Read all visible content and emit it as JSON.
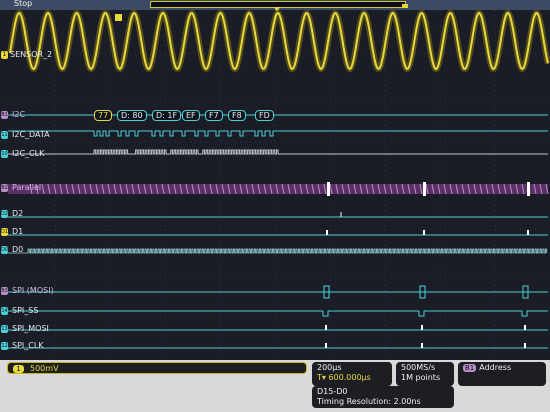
{
  "topbar": {
    "state": "Stop"
  },
  "trace_labels": {
    "sensor": "SENSOR_2",
    "i2c_bus": "I2C",
    "i2c_data": "I2C_DATA",
    "i2c_clk": "I2C_CLK",
    "parallel_bus": "Parallel",
    "d2": "D2",
    "d1": "D1",
    "d0": "D0",
    "spi_bus": "SPI (MOSI)",
    "spi_ss": "SPI_SS",
    "spi_mosi": "SPI_MOSI",
    "spi_clk": "SPI_CLK"
  },
  "channel_marks": {
    "ch1": "1",
    "b1": "B1",
    "d11": "11",
    "d10": "10",
    "b2": "B2",
    "d2": "D2",
    "d1": "D1",
    "d0": "D0",
    "b3": "B3",
    "d14": "14",
    "d13": "13",
    "d12": "12"
  },
  "i2c_packets": [
    "77",
    "D: 80",
    "D: 1F",
    "EF",
    "F7",
    "F8",
    "FD"
  ],
  "status": {
    "ch1_chip": "1",
    "ch1_scale": "500mV",
    "timebase": "200µs",
    "trigger_pos": "T▾ 600.000µs",
    "sample_rate": "500MS/s",
    "record_length": "1M points",
    "trigger_chip": "B1",
    "trigger_type": "Address",
    "digital_group": "D15-D0",
    "timing_resolution": "Timing Resolution: 2.00ns"
  },
  "colors": {
    "background": "#1a1c26",
    "analog": "#e8d840",
    "digital": "#4ccfd8",
    "bus_purple": "#b88ec8",
    "status_bar": "#d9d9d9"
  }
}
